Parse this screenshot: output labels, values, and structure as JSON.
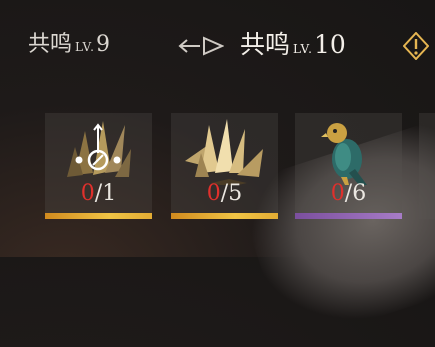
{
  "header": {
    "current": {
      "prefix": "共鸣",
      "lv_label": "LV.",
      "level": "9"
    },
    "next": {
      "prefix": "共鸣",
      "lv_label": "LV.",
      "level": "10"
    },
    "arrow_icon": "arrow-to-triangle-icon",
    "warning_icon": "exclamation-diamond-icon"
  },
  "materials": [
    {
      "icon": "golden-crystal-sigil-icon",
      "have": "0",
      "sep": "/",
      "need": "1",
      "rarity_color": "#f0c445"
    },
    {
      "icon": "golden-crystal-cluster-icon",
      "have": "0",
      "sep": "/",
      "need": "5",
      "rarity_color": "#f0c445"
    },
    {
      "icon": "teal-bird-figurine-icon",
      "have": "0",
      "sep": "/",
      "need": "6",
      "rarity_color": "#a77cc7"
    }
  ],
  "colors": {
    "insufficient": "#e0302c",
    "gold": "#f0c445",
    "purple": "#a77cc7"
  }
}
